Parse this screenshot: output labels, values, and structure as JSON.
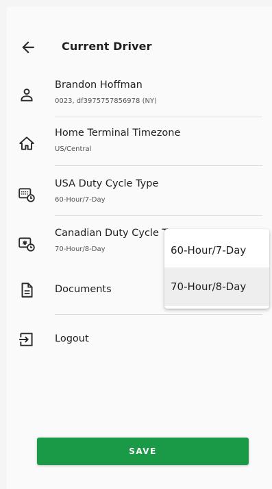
{
  "header": {
    "title": "Current Driver"
  },
  "items": [
    {
      "label": "Brandon Hoffman",
      "sub": "0023, df3975757856978 (NY)"
    },
    {
      "label": "Home Terminal Timezone",
      "sub": "US/Central"
    },
    {
      "label": "USA Duty Cycle Type",
      "sub": "60-Hour/7-Day"
    },
    {
      "label": "Canadian Duty Cycle T",
      "sub": "70-Hour/8-Day"
    },
    {
      "label": "Documents"
    },
    {
      "label": "Logout"
    }
  ],
  "dropdown": {
    "options": [
      "60-Hour/7-Day",
      "70-Hour/8-Day"
    ],
    "selected": "70-Hour/8-Day"
  },
  "save_label": "SAVE",
  "colors": {
    "accent": "#1a9a47",
    "background": "#fafafa",
    "divider": "#dcdcdc"
  }
}
